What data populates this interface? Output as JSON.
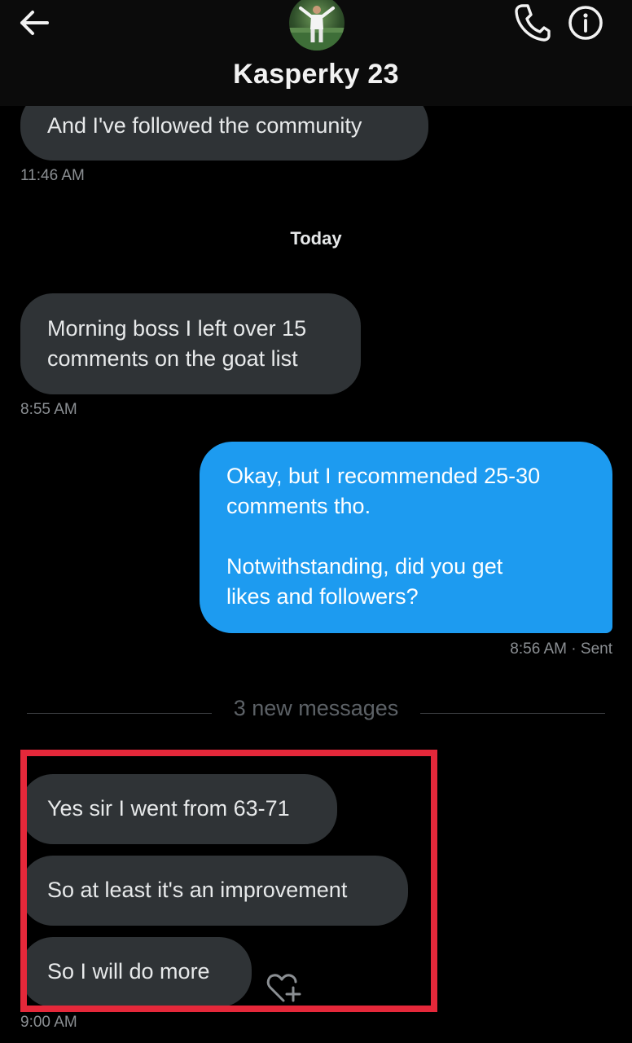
{
  "header": {
    "title": "Kasperky 23",
    "back_icon": "arrow-left-icon",
    "call_icon": "phone-icon",
    "info_icon": "info-circle-icon"
  },
  "messages": [
    {
      "direction": "in",
      "text": "And I've followed the community"
    },
    {
      "direction": "in",
      "text": "Morning boss I left over 15\ncomments on the goat list"
    },
    {
      "direction": "out",
      "text": "Okay, but I recommended 25-30\ncomments tho.\n\nNotwithstanding, did you get\nlikes and followers?"
    },
    {
      "direction": "in",
      "text": "Yes sir I went from 63-71"
    },
    {
      "direction": "in",
      "text": "So at least it's an improvement"
    },
    {
      "direction": "in",
      "text": "So I will do more"
    }
  ],
  "timestamps": {
    "t1": "11:46 AM",
    "t2": "8:55 AM",
    "t3": "8:56 AM",
    "t3_status": "· Sent",
    "t4": "9:00 AM"
  },
  "separators": {
    "day": "Today",
    "new_messages": "3 new messages"
  },
  "colors": {
    "background": "#000000",
    "incoming_bubble": "#2f3336",
    "outgoing_bubble": "#1d9bf0",
    "highlight_border": "#e5283a"
  }
}
